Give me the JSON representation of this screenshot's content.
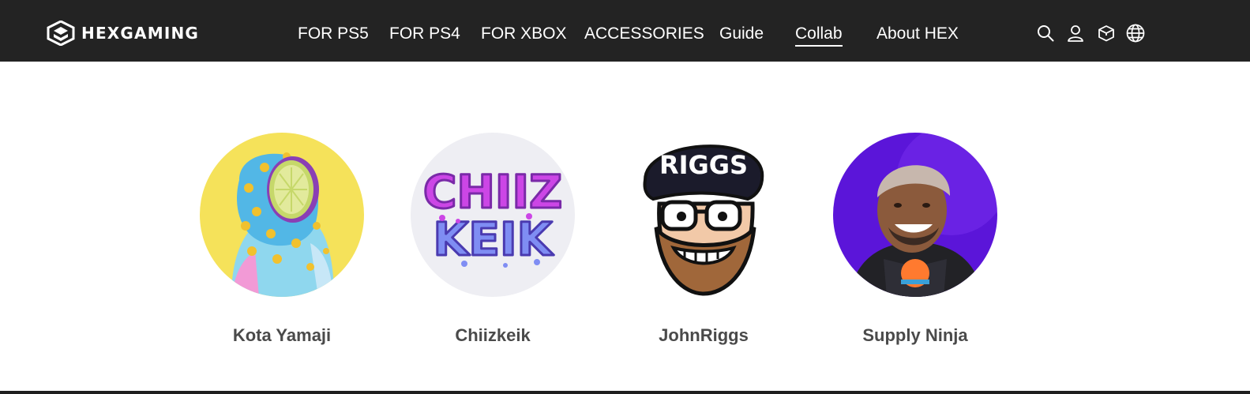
{
  "brand": {
    "name": "HEXGAMING"
  },
  "nav": {
    "items": [
      {
        "label": "FOR PS5"
      },
      {
        "label": "FOR PS4"
      },
      {
        "label": "FOR XBOX"
      },
      {
        "label": "ACCESSORIES"
      },
      {
        "label": "Guide"
      },
      {
        "label": "Collab",
        "active": true
      },
      {
        "label": "About HEX"
      }
    ]
  },
  "header_icons": [
    "search-icon",
    "user-icon",
    "cart-icon",
    "globe-icon"
  ],
  "collaborators": [
    {
      "name": "Kota Yamaji"
    },
    {
      "name": "Chiizkeik"
    },
    {
      "name": "JohnRiggs"
    },
    {
      "name": "Supply Ninja"
    }
  ],
  "colors": {
    "header_bg": "#232323",
    "header_text": "#ffffff",
    "name_text": "#4a4a4a",
    "avatar_kota_bg": "#f5e25a",
    "avatar_chiiz_bg": "#eeeef3",
    "avatar_supply_bg": "#5b15d9"
  }
}
